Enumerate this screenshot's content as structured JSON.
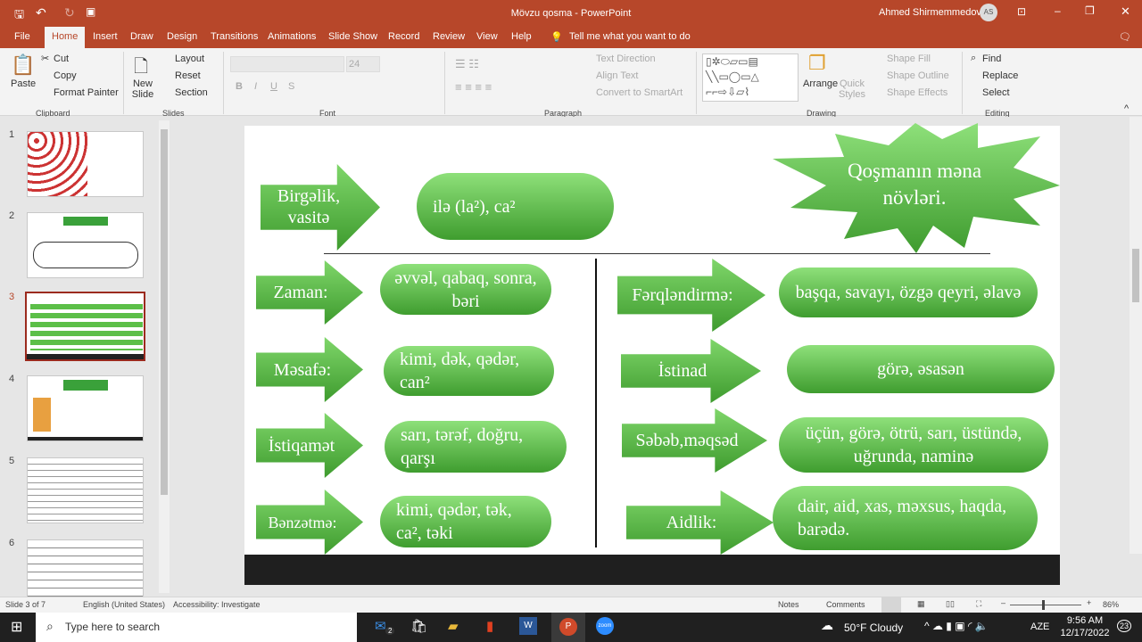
{
  "window": {
    "title": "Mövzu qosma  -  PowerPoint",
    "user": "Ahmed Shirmemmedov",
    "user_initials": "AS"
  },
  "tabs": [
    "File",
    "Home",
    "Insert",
    "Draw",
    "Design",
    "Transitions",
    "Animations",
    "Slide Show",
    "Record",
    "Review",
    "View",
    "Help"
  ],
  "tell_me": "Tell me what you want to do",
  "ribbon": {
    "clipboard": {
      "paste": "Paste",
      "cut": "Cut",
      "copy": "Copy",
      "format_painter": "Format Painter",
      "label": "Clipboard"
    },
    "slides": {
      "new_slide": "New Slide",
      "layout": "Layout",
      "reset": "Reset",
      "section": "Section",
      "label": "Slides"
    },
    "font": {
      "size": "24",
      "label": "Font",
      "bold": "B",
      "italic": "I",
      "underline": "U",
      "strike": "S"
    },
    "paragraph": {
      "text_direction": "Text Direction",
      "align_text": "Align Text",
      "convert": "Convert to SmartArt",
      "label": "Paragraph"
    },
    "drawing": {
      "arrange": "Arrange",
      "quick_styles": "Quick Styles",
      "shape_fill": "Shape Fill",
      "shape_outline": "Shape Outline",
      "shape_effects": "Shape Effects",
      "label": "Drawing"
    },
    "editing": {
      "find": "Find",
      "replace": "Replace",
      "select": "Select",
      "label": "Editing"
    }
  },
  "thumbnails": [
    "1",
    "2",
    "3",
    "4",
    "5",
    "6"
  ],
  "slide": {
    "title": "Qoşmanın məna növləri.",
    "top": {
      "arrow": "Birgəlik, vasitə",
      "pill": "ilə (la²), ca²"
    },
    "left": [
      {
        "arrow": "Zaman:",
        "pill": "əvvəl, qabaq, sonra, bəri"
      },
      {
        "arrow": "Məsafə:",
        "pill": "kimi, dək, qədər, can²"
      },
      {
        "arrow": "İstiqamət",
        "pill": "sarı, tərəf, doğru, qarşı"
      },
      {
        "arrow": "Bənzətmə:",
        "pill": "kimi, qədər, tək, ca², təki"
      }
    ],
    "right": [
      {
        "arrow": "Fərqləndirmə:",
        "pill": "başqa, savayı, özgə qeyri, əlavə"
      },
      {
        "arrow": "İstinad",
        "pill": "görə, əsasən"
      },
      {
        "arrow": "Səbəb,məqsəd",
        "pill": "üçün, görə, ötrü, sarı, üstündə, uğrunda, naminə"
      },
      {
        "arrow": "Aidlik:",
        "pill": "dair, aid, xas, məxsus, haqda, barədə."
      }
    ]
  },
  "status": {
    "slide": "Slide 3 of 7",
    "language": "English (United States)",
    "accessibility": "Accessibility: Investigate",
    "notes": "Notes",
    "comments": "Comments",
    "zoom": "86%"
  },
  "taskbar": {
    "search": "Type here to search",
    "weather": "50°F  Cloudy",
    "lang": "AZE",
    "time": "9:56 AM",
    "date": "12/17/2022",
    "notif": "23",
    "mail_badge": "2"
  },
  "colors": {
    "accent": "#b7472a",
    "green": "#4caf3a"
  }
}
